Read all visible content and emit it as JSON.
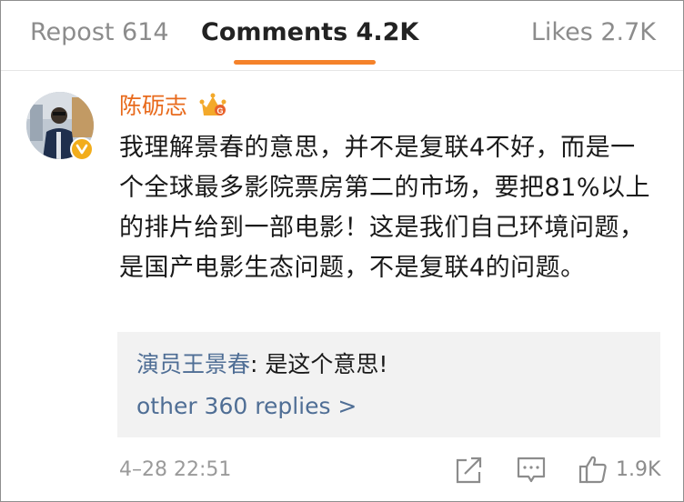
{
  "tabs": {
    "repost": "Repost 614",
    "comments": "Comments 4.2K",
    "likes": "Likes 2.7K",
    "active": "comments",
    "accent_color": "#f5822a"
  },
  "comment": {
    "author": "陈砺志",
    "author_color": "#e86a1c",
    "badge_icon": "crown-icon",
    "verified_icon": "verified-icon",
    "text": "我理解景春的意思，并不是复联4不好，而是一个全球最多影院票房第二的市场，要把81%以上的排片给到一部电影！这是我们自己环境问题，是国产电影生态问题，不是复联4的问题。",
    "timestamp": "4–28 22:51",
    "like_count": "1.9K"
  },
  "reply": {
    "author": "演员王景春",
    "text": ": 是这个意思!",
    "more_label": "other 360 replies >",
    "link_color": "#4f6e95"
  },
  "actions": [
    "share-icon",
    "comment-icon",
    "like-icon"
  ]
}
